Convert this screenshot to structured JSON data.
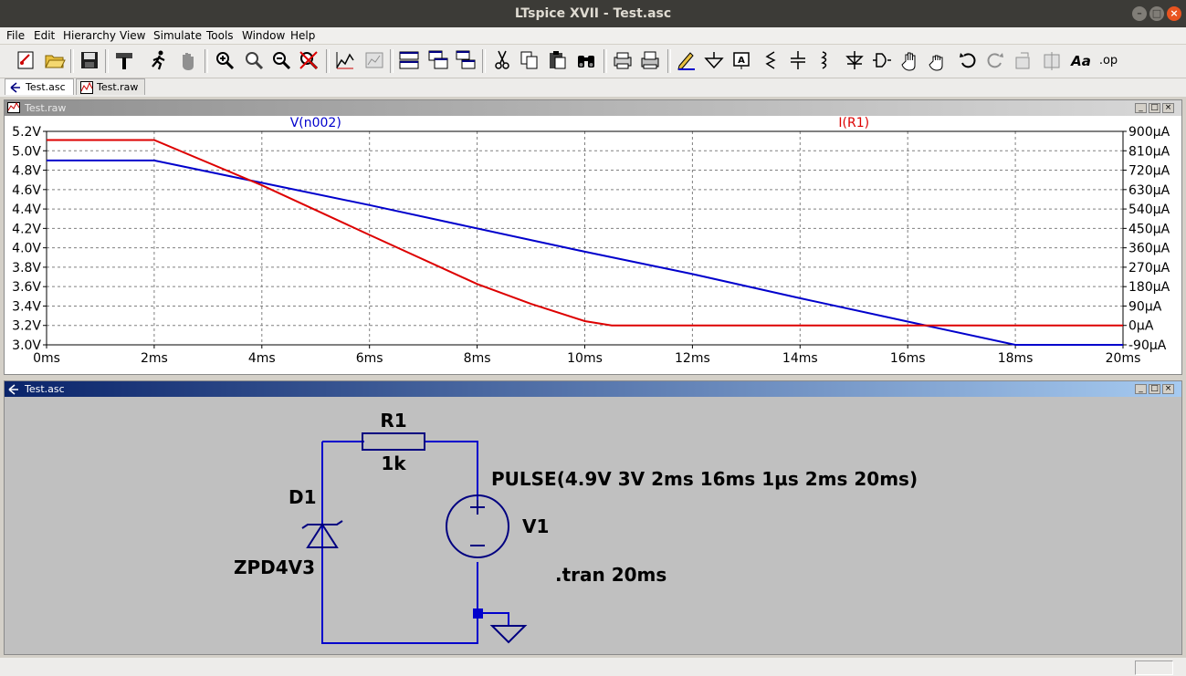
{
  "window": {
    "title": "LTspice XVII - Test.asc"
  },
  "menu": [
    "File",
    "Edit",
    "Hierarchy",
    "View",
    "Simulate",
    "Tools",
    "Window",
    "Help"
  ],
  "toolbar_icons": [
    "new-schematic",
    "open-folder",
    "save-disk",
    "control-panel-hammer",
    "run-simulation",
    "halt-simulation",
    "zoom-in",
    "zoom-pan",
    "zoom-out",
    "zoom-cancel",
    "autorange",
    "plot-settings",
    "tile-horizontal",
    "cascade",
    "tile-vertical",
    "cut-scissors",
    "copy",
    "paste",
    "find-binoculars",
    "print-preview",
    "print",
    "draw-wire",
    "ground",
    "label-net",
    "resistor",
    "capacitor",
    "inductor",
    "diode",
    "component",
    "move-hand",
    "drag-hand",
    "undo",
    "redo",
    "rotate",
    "mirror",
    "text",
    "spice-directive"
  ],
  "tabs": [
    {
      "label": "Test.asc",
      "icon": "schematic-tab-icon",
      "active": true
    },
    {
      "label": "Test.raw",
      "icon": "waveform-tab-icon",
      "active": false
    }
  ],
  "plot_window": {
    "title": "Test.raw"
  },
  "schematic_window": {
    "title": "Test.asc"
  },
  "chart_data": {
    "type": "line",
    "series": [
      {
        "name": "V(n002)",
        "color": "#0000cc",
        "axis": "left",
        "x": [
          0,
          2,
          4,
          6,
          8,
          10,
          12,
          14,
          16,
          18,
          20
        ],
        "y": [
          4.9,
          4.9,
          4.67,
          4.44,
          4.2,
          3.96,
          3.73,
          3.48,
          3.24,
          3.0,
          3.0
        ]
      },
      {
        "name": "I(R1)",
        "color": "#dd0000",
        "axis": "right",
        "x": [
          0,
          2,
          4,
          6,
          8,
          9,
          10,
          10.5,
          12,
          14,
          16,
          18,
          20
        ],
        "y": [
          860,
          860,
          650,
          420,
          192,
          100,
          20,
          0,
          0,
          0,
          0,
          0,
          0
        ]
      }
    ],
    "xticks": [
      "0ms",
      "2ms",
      "4ms",
      "6ms",
      "8ms",
      "10ms",
      "12ms",
      "14ms",
      "16ms",
      "18ms",
      "20ms"
    ],
    "yticks_left": [
      "5.2V",
      "5.0V",
      "4.8V",
      "4.6V",
      "4.4V",
      "4.2V",
      "4.0V",
      "3.8V",
      "3.6V",
      "3.4V",
      "3.2V",
      "3.0V"
    ],
    "yticks_right": [
      "900µA",
      "810µA",
      "720µA",
      "630µA",
      "540µA",
      "450µA",
      "360µA",
      "270µA",
      "180µA",
      "90µA",
      "0µA",
      "-90µA"
    ],
    "xlim": [
      0,
      20
    ],
    "ylim_left": [
      3.0,
      5.2
    ],
    "ylim_right": [
      -90,
      900
    ],
    "grid": true,
    "grid_color": "#808080"
  },
  "schematic": {
    "r1_name": "R1",
    "r1_value": "1k",
    "d1_name": "D1",
    "d1_value": "ZPD4V3",
    "v1_name": "V1",
    "v1_value": "PULSE(4.9V 3V 2ms 16ms 1µs 2ms 20ms)",
    "directive": ".tran 20ms",
    "wire_color": "#0000cc",
    "component_color": "#000080"
  }
}
